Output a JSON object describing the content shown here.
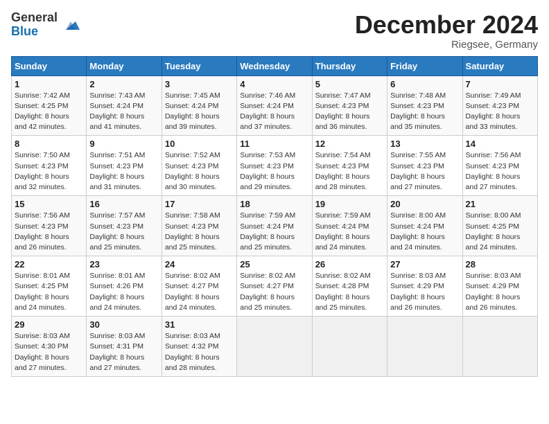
{
  "logo": {
    "general": "General",
    "blue": "Blue"
  },
  "title": {
    "month_year": "December 2024",
    "location": "Riegsee, Germany"
  },
  "headers": [
    "Sunday",
    "Monday",
    "Tuesday",
    "Wednesday",
    "Thursday",
    "Friday",
    "Saturday"
  ],
  "weeks": [
    [
      {
        "day": "1",
        "info": "Sunrise: 7:42 AM\nSunset: 4:25 PM\nDaylight: 8 hours\nand 42 minutes."
      },
      {
        "day": "2",
        "info": "Sunrise: 7:43 AM\nSunset: 4:24 PM\nDaylight: 8 hours\nand 41 minutes."
      },
      {
        "day": "3",
        "info": "Sunrise: 7:45 AM\nSunset: 4:24 PM\nDaylight: 8 hours\nand 39 minutes."
      },
      {
        "day": "4",
        "info": "Sunrise: 7:46 AM\nSunset: 4:24 PM\nDaylight: 8 hours\nand 37 minutes."
      },
      {
        "day": "5",
        "info": "Sunrise: 7:47 AM\nSunset: 4:23 PM\nDaylight: 8 hours\nand 36 minutes."
      },
      {
        "day": "6",
        "info": "Sunrise: 7:48 AM\nSunset: 4:23 PM\nDaylight: 8 hours\nand 35 minutes."
      },
      {
        "day": "7",
        "info": "Sunrise: 7:49 AM\nSunset: 4:23 PM\nDaylight: 8 hours\nand 33 minutes."
      }
    ],
    [
      {
        "day": "8",
        "info": "Sunrise: 7:50 AM\nSunset: 4:23 PM\nDaylight: 8 hours\nand 32 minutes."
      },
      {
        "day": "9",
        "info": "Sunrise: 7:51 AM\nSunset: 4:23 PM\nDaylight: 8 hours\nand 31 minutes."
      },
      {
        "day": "10",
        "info": "Sunrise: 7:52 AM\nSunset: 4:23 PM\nDaylight: 8 hours\nand 30 minutes."
      },
      {
        "day": "11",
        "info": "Sunrise: 7:53 AM\nSunset: 4:23 PM\nDaylight: 8 hours\nand 29 minutes."
      },
      {
        "day": "12",
        "info": "Sunrise: 7:54 AM\nSunset: 4:23 PM\nDaylight: 8 hours\nand 28 minutes."
      },
      {
        "day": "13",
        "info": "Sunrise: 7:55 AM\nSunset: 4:23 PM\nDaylight: 8 hours\nand 27 minutes."
      },
      {
        "day": "14",
        "info": "Sunrise: 7:56 AM\nSunset: 4:23 PM\nDaylight: 8 hours\nand 27 minutes."
      }
    ],
    [
      {
        "day": "15",
        "info": "Sunrise: 7:56 AM\nSunset: 4:23 PM\nDaylight: 8 hours\nand 26 minutes."
      },
      {
        "day": "16",
        "info": "Sunrise: 7:57 AM\nSunset: 4:23 PM\nDaylight: 8 hours\nand 25 minutes."
      },
      {
        "day": "17",
        "info": "Sunrise: 7:58 AM\nSunset: 4:23 PM\nDaylight: 8 hours\nand 25 minutes."
      },
      {
        "day": "18",
        "info": "Sunrise: 7:59 AM\nSunset: 4:24 PM\nDaylight: 8 hours\nand 25 minutes."
      },
      {
        "day": "19",
        "info": "Sunrise: 7:59 AM\nSunset: 4:24 PM\nDaylight: 8 hours\nand 24 minutes."
      },
      {
        "day": "20",
        "info": "Sunrise: 8:00 AM\nSunset: 4:24 PM\nDaylight: 8 hours\nand 24 minutes."
      },
      {
        "day": "21",
        "info": "Sunrise: 8:00 AM\nSunset: 4:25 PM\nDaylight: 8 hours\nand 24 minutes."
      }
    ],
    [
      {
        "day": "22",
        "info": "Sunrise: 8:01 AM\nSunset: 4:25 PM\nDaylight: 8 hours\nand 24 minutes."
      },
      {
        "day": "23",
        "info": "Sunrise: 8:01 AM\nSunset: 4:26 PM\nDaylight: 8 hours\nand 24 minutes."
      },
      {
        "day": "24",
        "info": "Sunrise: 8:02 AM\nSunset: 4:27 PM\nDaylight: 8 hours\nand 24 minutes."
      },
      {
        "day": "25",
        "info": "Sunrise: 8:02 AM\nSunset: 4:27 PM\nDaylight: 8 hours\nand 25 minutes."
      },
      {
        "day": "26",
        "info": "Sunrise: 8:02 AM\nSunset: 4:28 PM\nDaylight: 8 hours\nand 25 minutes."
      },
      {
        "day": "27",
        "info": "Sunrise: 8:03 AM\nSunset: 4:29 PM\nDaylight: 8 hours\nand 26 minutes."
      },
      {
        "day": "28",
        "info": "Sunrise: 8:03 AM\nSunset: 4:29 PM\nDaylight: 8 hours\nand 26 minutes."
      }
    ],
    [
      {
        "day": "29",
        "info": "Sunrise: 8:03 AM\nSunset: 4:30 PM\nDaylight: 8 hours\nand 27 minutes."
      },
      {
        "day": "30",
        "info": "Sunrise: 8:03 AM\nSunset: 4:31 PM\nDaylight: 8 hours\nand 27 minutes."
      },
      {
        "day": "31",
        "info": "Sunrise: 8:03 AM\nSunset: 4:32 PM\nDaylight: 8 hours\nand 28 minutes."
      },
      null,
      null,
      null,
      null
    ]
  ]
}
